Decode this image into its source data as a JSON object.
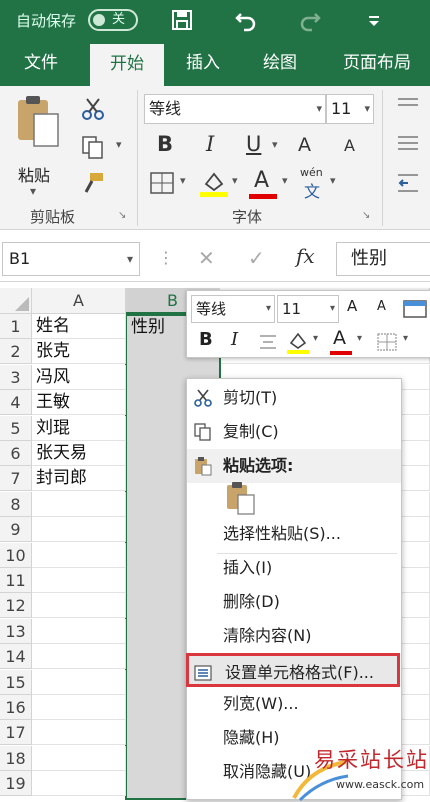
{
  "titlebar": {
    "autosave_label": "自动保存",
    "toggle_state": "关"
  },
  "tabs": [
    {
      "label": "文件"
    },
    {
      "label": "开始"
    },
    {
      "label": "插入"
    },
    {
      "label": "绘图"
    },
    {
      "label": "页面布局"
    }
  ],
  "ribbon": {
    "paste_label": "粘贴",
    "clipboard_label": "剪贴板",
    "font_group_label": "字体",
    "font_name": "等线",
    "font_size": "11",
    "bold": "B",
    "italic": "I",
    "underline": "U",
    "grow": "A",
    "shrink": "A",
    "font_color": "A",
    "phonetic": "wén"
  },
  "formula_bar": {
    "name_box": "B1",
    "fx": "fx",
    "content": "性别"
  },
  "columns": [
    {
      "label": "A"
    },
    {
      "label": "B"
    }
  ],
  "rows": [
    "1",
    "2",
    "3",
    "4",
    "5",
    "6",
    "7",
    "8",
    "9",
    "10",
    "11",
    "12",
    "13",
    "14",
    "15",
    "16",
    "17",
    "18",
    "19"
  ],
  "cells_a": [
    "姓名",
    "张克",
    "冯风",
    "王敏",
    "刘琨",
    "张天易",
    "封司郎"
  ],
  "cell_b1": "性别",
  "mini_toolbar": {
    "font_name": "等线",
    "font_size": "11",
    "bold": "B",
    "italic": "I",
    "grow": "A",
    "shrink": "A",
    "font_color": "A"
  },
  "context_menu": {
    "cut": "剪切(T)",
    "copy": "复制(C)",
    "paste_options": "粘贴选项:",
    "paste_special": "选择性粘贴(S)...",
    "insert": "插入(I)",
    "delete": "删除(D)",
    "clear": "清除内容(N)",
    "format_cells": "设置单元格格式(F)...",
    "col_width": "列宽(W)...",
    "hide": "隐藏(H)",
    "unhide": "取消隐藏(U)"
  },
  "watermark": {
    "text": "易采站长站",
    "url": "www.easck.com"
  },
  "colors": {
    "excel_green": "#217346",
    "selection_gray": "#d8d8d8",
    "highlight_red": "#d9363e"
  }
}
